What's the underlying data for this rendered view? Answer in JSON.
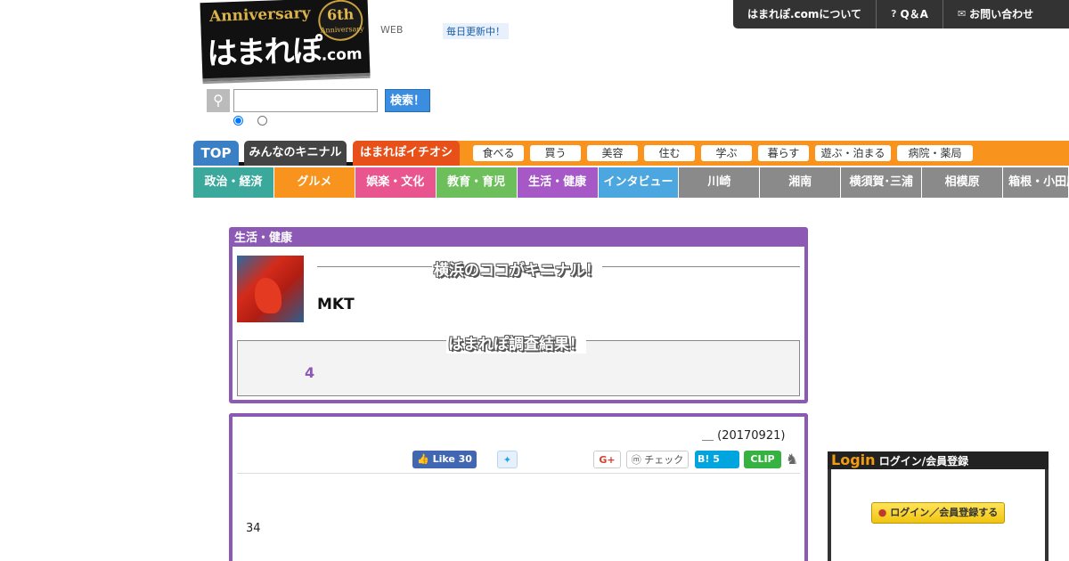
{
  "logo": {
    "anniversary": "Anniversary",
    "seal_number": "6th",
    "seal_word": "Anniversary",
    "name": "はまれぽ",
    "domain": ".com"
  },
  "header": {
    "web_label": "WEB",
    "update_badge": "毎日更新中！"
  },
  "top_links": [
    {
      "label": "はまれぽ.comについて",
      "icon": ""
    },
    {
      "label": "Q＆A",
      "icon": "question-circle-icon"
    },
    {
      "label": "お問い合わせ",
      "icon": "mail-icon"
    }
  ],
  "search": {
    "value": "",
    "button": "検索！",
    "icon": "search-icon"
  },
  "nav1": {
    "top": "TOP",
    "kininaru": "みんなのキニナル",
    "ichioshi": "はまれぽイチオシ",
    "pills": [
      "食べる",
      "買う",
      "美容",
      "住む",
      "学ぶ",
      "暮らす",
      "遊ぶ・泊まる",
      "病院・薬局"
    ]
  },
  "nav2": [
    {
      "label": "政治・経済",
      "color": "#3aa89a"
    },
    {
      "label": "グルメ",
      "color": "#f8931d"
    },
    {
      "label": "娯楽・文化",
      "color": "#e8558f"
    },
    {
      "label": "教育・育児",
      "color": "#6cbf5b"
    },
    {
      "label": "生活・健康",
      "color": "#a558c6"
    },
    {
      "label": "インタビュー",
      "color": "#4ca6e0"
    },
    {
      "label": "川崎",
      "color": "#8a8a8a"
    },
    {
      "label": "湘南",
      "color": "#8a8a8a"
    },
    {
      "label": "横須賀･三浦",
      "color": "#8a8a8a"
    },
    {
      "label": "相模原",
      "color": "#8a8a8a"
    },
    {
      "label": "箱根・小田原",
      "color": "#8a8a8a"
    }
  ],
  "article": {
    "category": "生活・健康",
    "kininaru_heading": "横浜のココがキニナル！",
    "title": "MKT",
    "result_heading": "はまれぽ調査結果！",
    "result_value": "4",
    "date": "＿ (20170921)",
    "body": "34"
  },
  "social": {
    "like": "Like 30",
    "twitter": "twitter-bird-icon",
    "gplus": "G+",
    "mixi": "チェック",
    "hatena": "B! 5",
    "clip": "CLIP",
    "evernote": "evernote-icon"
  },
  "login": {
    "logo": "Login",
    "heading": "ログイン/会員登録",
    "button": "ログイン／会員登録する"
  }
}
